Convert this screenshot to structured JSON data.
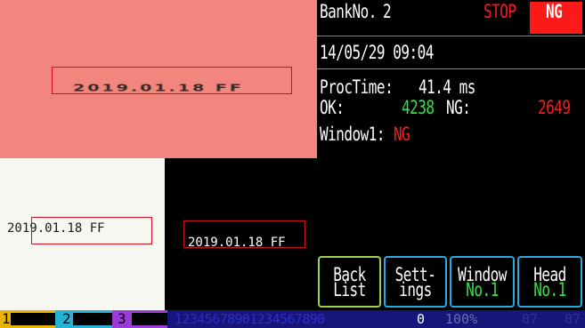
{
  "header": {
    "bank_label": "BankNo.",
    "bank_number": "2",
    "run_state": "STOP",
    "judgement": "NG",
    "datetime": "14/05/29 09:04"
  },
  "stats": {
    "proc_label": "ProcTime:",
    "proc_value": "41.4 ms",
    "ok_label": "OK:",
    "ok_count": "4238",
    "ng_label": "NG:",
    "ng_count": "2649",
    "window_label": "Window1:",
    "window_result": "NG"
  },
  "camera": {
    "main_text": "2019.01.18 FF",
    "left_text": "2019.01.18 FF",
    "right_text": "2019.01.18 FF"
  },
  "buttons": {
    "back_line1": "Back",
    "back_line2": "List",
    "settings_line1": "Sett-",
    "settings_line2": "ings",
    "window_line1": "Window",
    "window_line2": "No.1",
    "head_line1": "Head",
    "head_line2": "No.1"
  },
  "statusbar": {
    "bank1": "1",
    "bank2": "2",
    "bank3": "3",
    "ocr_string": "12345678901234567890",
    "zero": "0",
    "percent": "100%",
    "counter_a": "07",
    "counter_b": "07"
  },
  "colors": {
    "ok_green": "#37e049",
    "ng_red": "#ff1a1a",
    "camera_bg": "#f2857d",
    "button_green_border": "#9bd24b",
    "button_blue_border": "#28a9df",
    "status_bar_blue": "#15157a"
  }
}
